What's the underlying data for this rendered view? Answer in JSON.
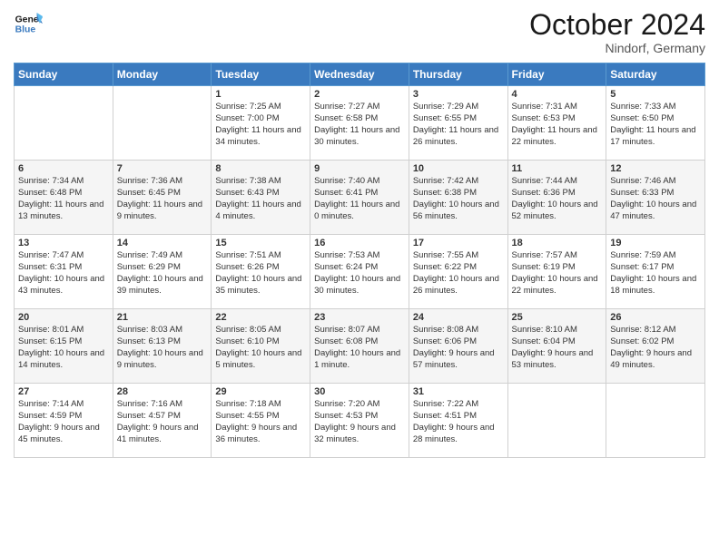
{
  "logo": {
    "line1": "General",
    "line2": "Blue"
  },
  "title": "October 2024",
  "location": "Nindorf, Germany",
  "days_header": [
    "Sunday",
    "Monday",
    "Tuesday",
    "Wednesday",
    "Thursday",
    "Friday",
    "Saturday"
  ],
  "weeks": [
    [
      {
        "day": "",
        "sunrise": "",
        "sunset": "",
        "daylight": ""
      },
      {
        "day": "",
        "sunrise": "",
        "sunset": "",
        "daylight": ""
      },
      {
        "day": "1",
        "sunrise": "Sunrise: 7:25 AM",
        "sunset": "Sunset: 7:00 PM",
        "daylight": "Daylight: 11 hours and 34 minutes."
      },
      {
        "day": "2",
        "sunrise": "Sunrise: 7:27 AM",
        "sunset": "Sunset: 6:58 PM",
        "daylight": "Daylight: 11 hours and 30 minutes."
      },
      {
        "day": "3",
        "sunrise": "Sunrise: 7:29 AM",
        "sunset": "Sunset: 6:55 PM",
        "daylight": "Daylight: 11 hours and 26 minutes."
      },
      {
        "day": "4",
        "sunrise": "Sunrise: 7:31 AM",
        "sunset": "Sunset: 6:53 PM",
        "daylight": "Daylight: 11 hours and 22 minutes."
      },
      {
        "day": "5",
        "sunrise": "Sunrise: 7:33 AM",
        "sunset": "Sunset: 6:50 PM",
        "daylight": "Daylight: 11 hours and 17 minutes."
      }
    ],
    [
      {
        "day": "6",
        "sunrise": "Sunrise: 7:34 AM",
        "sunset": "Sunset: 6:48 PM",
        "daylight": "Daylight: 11 hours and 13 minutes."
      },
      {
        "day": "7",
        "sunrise": "Sunrise: 7:36 AM",
        "sunset": "Sunset: 6:45 PM",
        "daylight": "Daylight: 11 hours and 9 minutes."
      },
      {
        "day": "8",
        "sunrise": "Sunrise: 7:38 AM",
        "sunset": "Sunset: 6:43 PM",
        "daylight": "Daylight: 11 hours and 4 minutes."
      },
      {
        "day": "9",
        "sunrise": "Sunrise: 7:40 AM",
        "sunset": "Sunset: 6:41 PM",
        "daylight": "Daylight: 11 hours and 0 minutes."
      },
      {
        "day": "10",
        "sunrise": "Sunrise: 7:42 AM",
        "sunset": "Sunset: 6:38 PM",
        "daylight": "Daylight: 10 hours and 56 minutes."
      },
      {
        "day": "11",
        "sunrise": "Sunrise: 7:44 AM",
        "sunset": "Sunset: 6:36 PM",
        "daylight": "Daylight: 10 hours and 52 minutes."
      },
      {
        "day": "12",
        "sunrise": "Sunrise: 7:46 AM",
        "sunset": "Sunset: 6:33 PM",
        "daylight": "Daylight: 10 hours and 47 minutes."
      }
    ],
    [
      {
        "day": "13",
        "sunrise": "Sunrise: 7:47 AM",
        "sunset": "Sunset: 6:31 PM",
        "daylight": "Daylight: 10 hours and 43 minutes."
      },
      {
        "day": "14",
        "sunrise": "Sunrise: 7:49 AM",
        "sunset": "Sunset: 6:29 PM",
        "daylight": "Daylight: 10 hours and 39 minutes."
      },
      {
        "day": "15",
        "sunrise": "Sunrise: 7:51 AM",
        "sunset": "Sunset: 6:26 PM",
        "daylight": "Daylight: 10 hours and 35 minutes."
      },
      {
        "day": "16",
        "sunrise": "Sunrise: 7:53 AM",
        "sunset": "Sunset: 6:24 PM",
        "daylight": "Daylight: 10 hours and 30 minutes."
      },
      {
        "day": "17",
        "sunrise": "Sunrise: 7:55 AM",
        "sunset": "Sunset: 6:22 PM",
        "daylight": "Daylight: 10 hours and 26 minutes."
      },
      {
        "day": "18",
        "sunrise": "Sunrise: 7:57 AM",
        "sunset": "Sunset: 6:19 PM",
        "daylight": "Daylight: 10 hours and 22 minutes."
      },
      {
        "day": "19",
        "sunrise": "Sunrise: 7:59 AM",
        "sunset": "Sunset: 6:17 PM",
        "daylight": "Daylight: 10 hours and 18 minutes."
      }
    ],
    [
      {
        "day": "20",
        "sunrise": "Sunrise: 8:01 AM",
        "sunset": "Sunset: 6:15 PM",
        "daylight": "Daylight: 10 hours and 14 minutes."
      },
      {
        "day": "21",
        "sunrise": "Sunrise: 8:03 AM",
        "sunset": "Sunset: 6:13 PM",
        "daylight": "Daylight: 10 hours and 9 minutes."
      },
      {
        "day": "22",
        "sunrise": "Sunrise: 8:05 AM",
        "sunset": "Sunset: 6:10 PM",
        "daylight": "Daylight: 10 hours and 5 minutes."
      },
      {
        "day": "23",
        "sunrise": "Sunrise: 8:07 AM",
        "sunset": "Sunset: 6:08 PM",
        "daylight": "Daylight: 10 hours and 1 minute."
      },
      {
        "day": "24",
        "sunrise": "Sunrise: 8:08 AM",
        "sunset": "Sunset: 6:06 PM",
        "daylight": "Daylight: 9 hours and 57 minutes."
      },
      {
        "day": "25",
        "sunrise": "Sunrise: 8:10 AM",
        "sunset": "Sunset: 6:04 PM",
        "daylight": "Daylight: 9 hours and 53 minutes."
      },
      {
        "day": "26",
        "sunrise": "Sunrise: 8:12 AM",
        "sunset": "Sunset: 6:02 PM",
        "daylight": "Daylight: 9 hours and 49 minutes."
      }
    ],
    [
      {
        "day": "27",
        "sunrise": "Sunrise: 7:14 AM",
        "sunset": "Sunset: 4:59 PM",
        "daylight": "Daylight: 9 hours and 45 minutes."
      },
      {
        "day": "28",
        "sunrise": "Sunrise: 7:16 AM",
        "sunset": "Sunset: 4:57 PM",
        "daylight": "Daylight: 9 hours and 41 minutes."
      },
      {
        "day": "29",
        "sunrise": "Sunrise: 7:18 AM",
        "sunset": "Sunset: 4:55 PM",
        "daylight": "Daylight: 9 hours and 36 minutes."
      },
      {
        "day": "30",
        "sunrise": "Sunrise: 7:20 AM",
        "sunset": "Sunset: 4:53 PM",
        "daylight": "Daylight: 9 hours and 32 minutes."
      },
      {
        "day": "31",
        "sunrise": "Sunrise: 7:22 AM",
        "sunset": "Sunset: 4:51 PM",
        "daylight": "Daylight: 9 hours and 28 minutes."
      },
      {
        "day": "",
        "sunrise": "",
        "sunset": "",
        "daylight": ""
      },
      {
        "day": "",
        "sunrise": "",
        "sunset": "",
        "daylight": ""
      }
    ]
  ]
}
